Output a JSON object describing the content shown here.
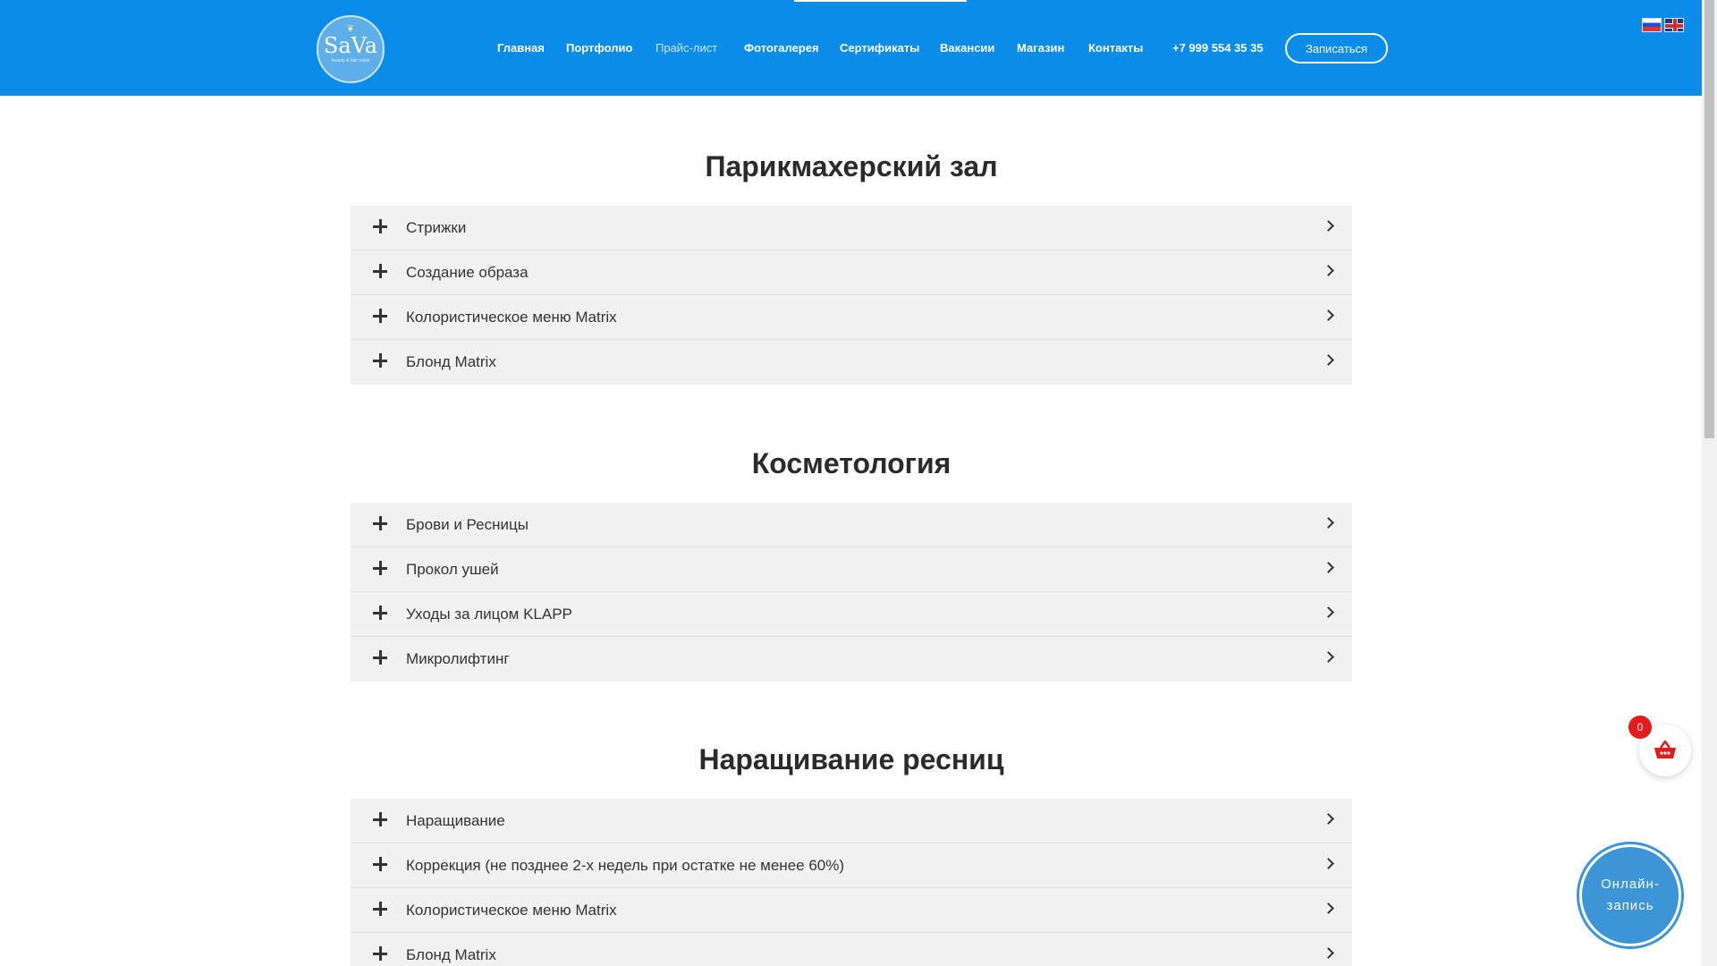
{
  "header": {
    "logo_text": "SaVa",
    "logo_subtitle": "beauty & hair salon",
    "nav": [
      {
        "label": "Главная"
      },
      {
        "label": "Портфолио"
      },
      {
        "label": "Прайс-лист"
      },
      {
        "label": "Фотогалерея"
      },
      {
        "label": "Сертификаты"
      },
      {
        "label": "Вакансии"
      },
      {
        "label": "Магазин"
      },
      {
        "label": "Контакты"
      }
    ],
    "phone": "+7 999 554 35 35",
    "signup_label": "Записаться",
    "languages": [
      "ru",
      "en"
    ],
    "colors": {
      "header_bg": "#0a8ce8",
      "accent": "#3b95d6",
      "badge": "#e31b1b"
    }
  },
  "sections": [
    {
      "title": "Парикмахерский зал",
      "items": [
        "Стрижки",
        "Создание образа",
        "Колористическое меню Matrix",
        "Блонд Matrix"
      ]
    },
    {
      "title": "Косметология",
      "items": [
        "Брови и Ресницы",
        "Прокол ушей",
        "Уходы за лицом KLAPP",
        "Микролифтинг"
      ]
    },
    {
      "title": "Наращивание ресниц",
      "items": [
        "Наращивание",
        "Коррекция (не позднее 2-х недель при остатке не менее 60%)",
        "Колористическое меню Matrix",
        "Блонд Matrix"
      ]
    }
  ],
  "cart": {
    "count": "0"
  },
  "online_booking": {
    "line1": "Онлайн-",
    "line2": "запись"
  }
}
